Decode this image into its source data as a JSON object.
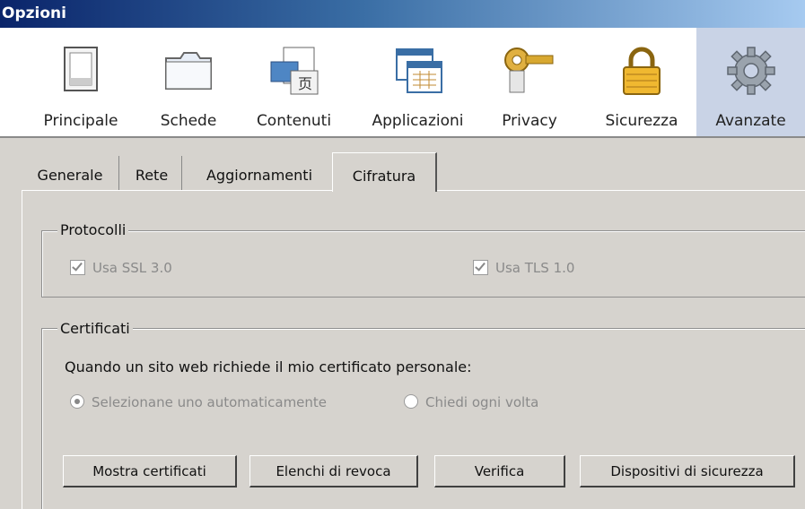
{
  "window": {
    "title": "Opzioni"
  },
  "toolbar": {
    "items": [
      {
        "label": "Principale",
        "icon": "window-icon"
      },
      {
        "label": "Schede",
        "icon": "folder-tabs-icon"
      },
      {
        "label": "Contenuti",
        "icon": "content-icon"
      },
      {
        "label": "Applicazioni",
        "icon": "applications-icon"
      },
      {
        "label": "Privacy",
        "icon": "key-icon"
      },
      {
        "label": "Sicurezza",
        "icon": "padlock-icon"
      },
      {
        "label": "Avanzate",
        "icon": "gear-icon"
      }
    ],
    "selected": "Avanzate"
  },
  "tabs": [
    "Generale",
    "Rete",
    "Aggiornamenti",
    "Cifratura"
  ],
  "active_tab": "Cifratura",
  "protocolli": {
    "title": "Protocolli",
    "ssl": "Usa SSL 3.0",
    "tls": "Usa TLS 1.0"
  },
  "certificati": {
    "title": "Certificati",
    "question": "Quando un sito web richiede il mio certificato personale:",
    "auto": "Selezionane uno automaticamente",
    "ask": "Chiedi ogni volta"
  },
  "buttons": {
    "show": "Mostra certificati",
    "revoke": "Elenchi di revoca",
    "verify": "Verifica",
    "devices": "Dispositivi di sicurezza"
  }
}
